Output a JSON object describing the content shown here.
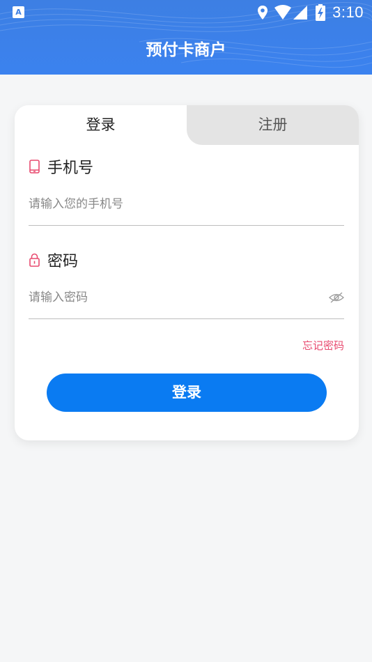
{
  "status_bar": {
    "notification_icon_letter": "A",
    "time": "3:10"
  },
  "header": {
    "title": "预付卡商户"
  },
  "tabs": {
    "login": "登录",
    "register": "注册"
  },
  "phone": {
    "label": "手机号",
    "placeholder": "请输入您的手机号",
    "value": ""
  },
  "password": {
    "label": "密码",
    "placeholder": "请输入密码",
    "value": ""
  },
  "forgot_password": "忘记密码",
  "login_button": "登录",
  "colors": {
    "header": "#3d7fe3",
    "primary_button": "#0a7bf2",
    "accent_pink": "#e84a6f",
    "background": "#f5f6f7"
  },
  "icons": {
    "phone_label_icon": "mobile-phone-icon",
    "password_label_icon": "lock-icon",
    "password_toggle_icon": "eye-hidden-icon",
    "status_icons": [
      "location-icon",
      "wifi-icon",
      "signal-icon",
      "battery-charging-icon"
    ]
  }
}
